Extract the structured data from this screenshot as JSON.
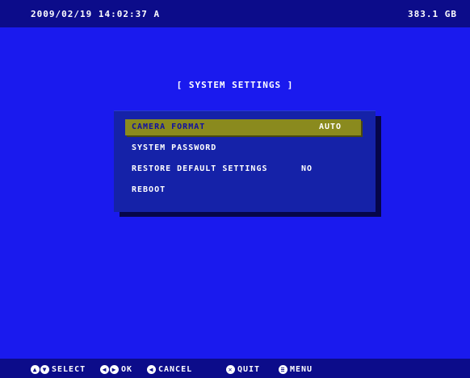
{
  "status_bar": {
    "datetime": "2009/02/19 14:02:37  A",
    "storage": "383.1 GB"
  },
  "menu": {
    "title": "[ SYSTEM SETTINGS ]",
    "items": [
      {
        "label": "CAMERA FORMAT",
        "value": "AUTO",
        "selected": true
      },
      {
        "label": "SYSTEM PASSWORD",
        "value": ""
      },
      {
        "label": "RESTORE DEFAULT SETTINGS",
        "value": "NO"
      },
      {
        "label": "REBOOT",
        "value": ""
      }
    ]
  },
  "hints": {
    "select": "SELECT",
    "ok": "OK",
    "cancel": "CANCEL",
    "quit": "QUIT",
    "menu": "MENU"
  },
  "icons": {
    "select": "up-down-arrows-icon",
    "ok": "left-right-arrows-icon",
    "cancel": "left-arrow-icon",
    "quit": "quit-icon",
    "menu": "menu-icon"
  },
  "colors": {
    "background": "#1a1aee",
    "bar": "#0c0c8a",
    "panel": "#1522a8",
    "highlight": "#8a8a1e"
  }
}
